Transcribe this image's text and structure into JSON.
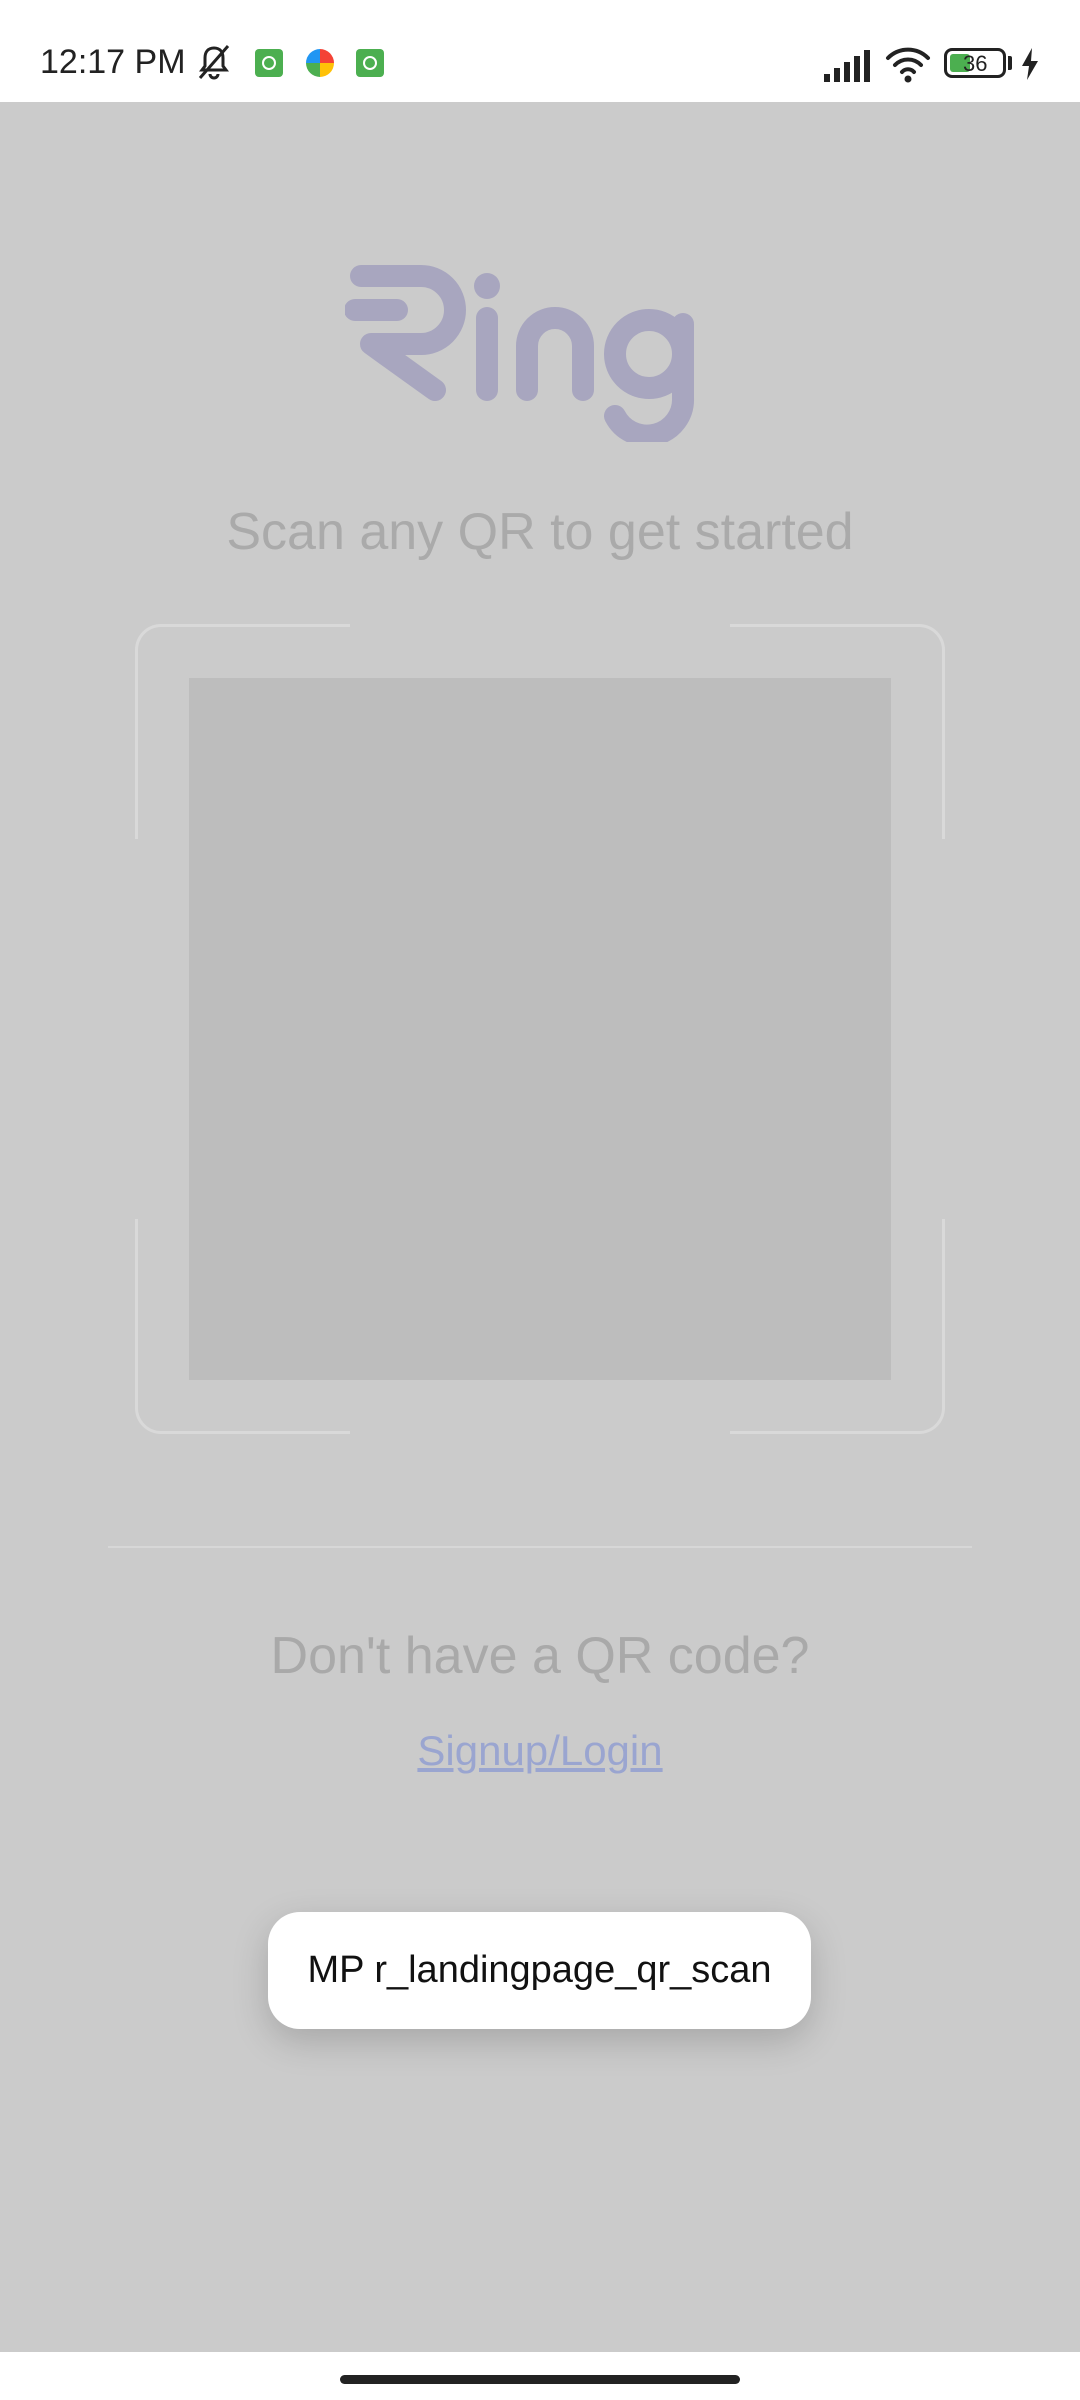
{
  "status_bar": {
    "time": "12:17 PM",
    "battery_level": "36",
    "icons": [
      "mute-icon",
      "app-notification-icon",
      "color-app-icon",
      "app-notification-icon",
      "signal-icon",
      "wifi-icon",
      "battery-icon",
      "charging-icon"
    ]
  },
  "app": {
    "logo_text": "Ring",
    "logo_color": "#a8a6bf",
    "tagline": "Scan any QR to get started",
    "no_qr_text": "Don't have a QR code?",
    "signup_link": "Signup/Login",
    "link_color": "#9aa5d0"
  },
  "toast": {
    "message": "MP r_landingpage_qr_scan"
  },
  "colors": {
    "overlay_background": "#cbcbcb",
    "camera_placeholder": "#bdbdbd"
  }
}
